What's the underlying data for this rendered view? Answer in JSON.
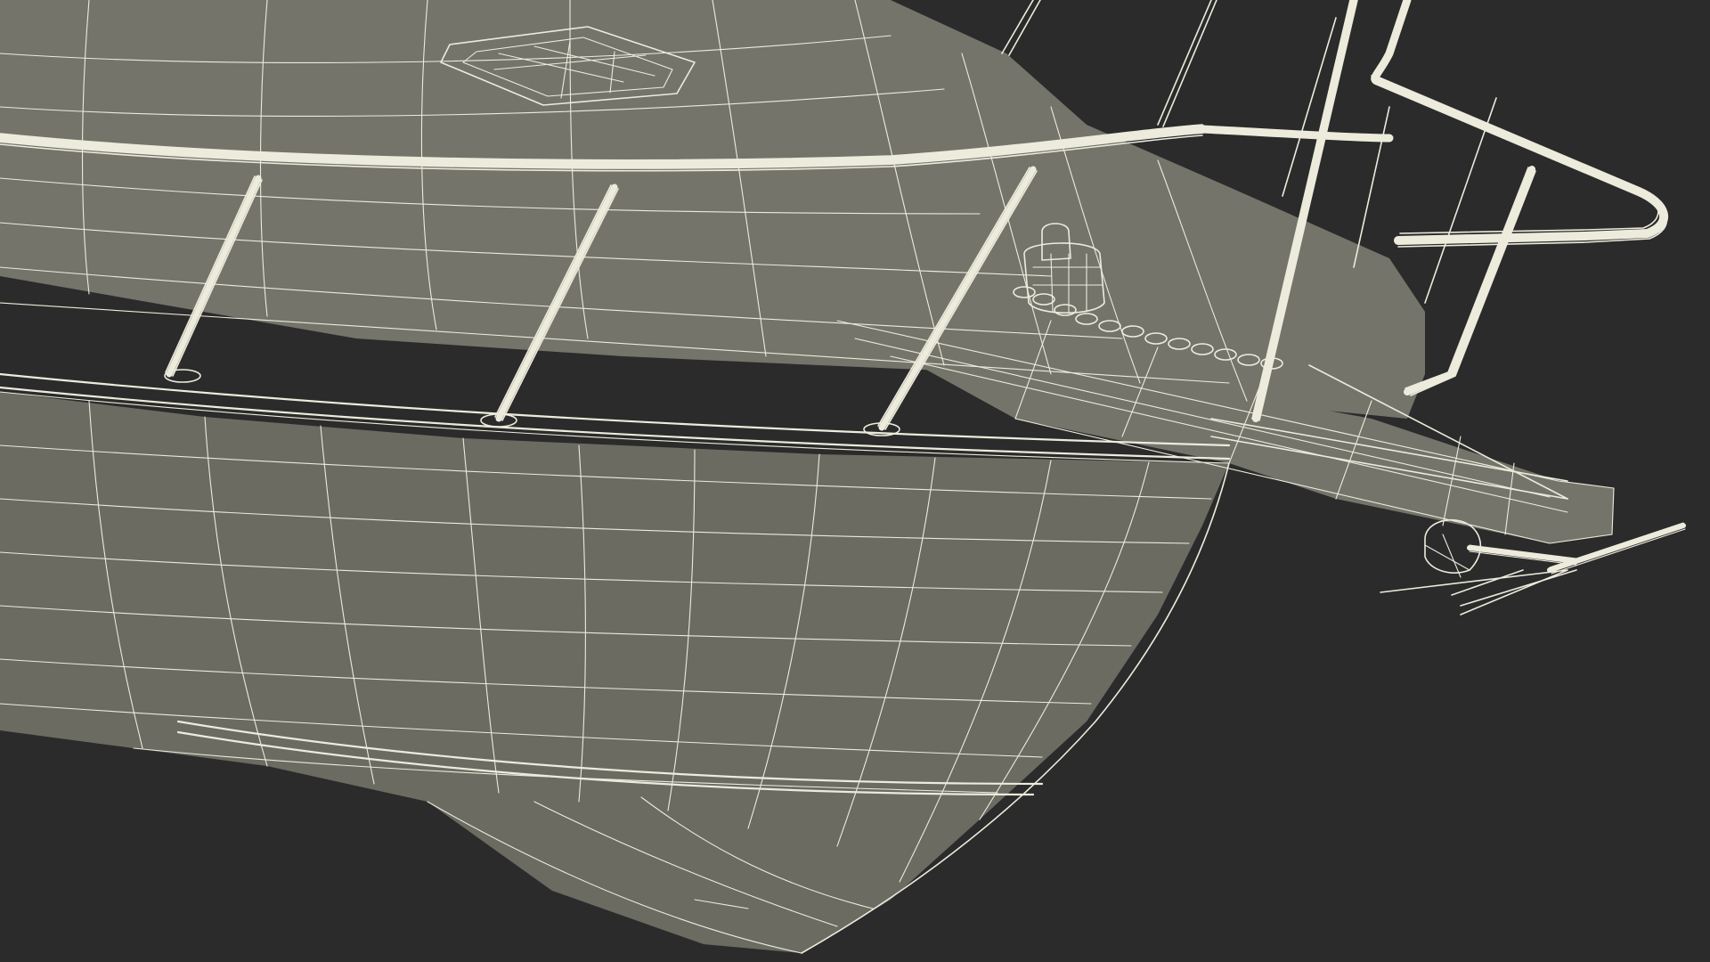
{
  "scene": {
    "background_color": "#2b2b2b",
    "mesh_fill_color": "#6f6f66",
    "wire_color": "#ecebdc"
  }
}
